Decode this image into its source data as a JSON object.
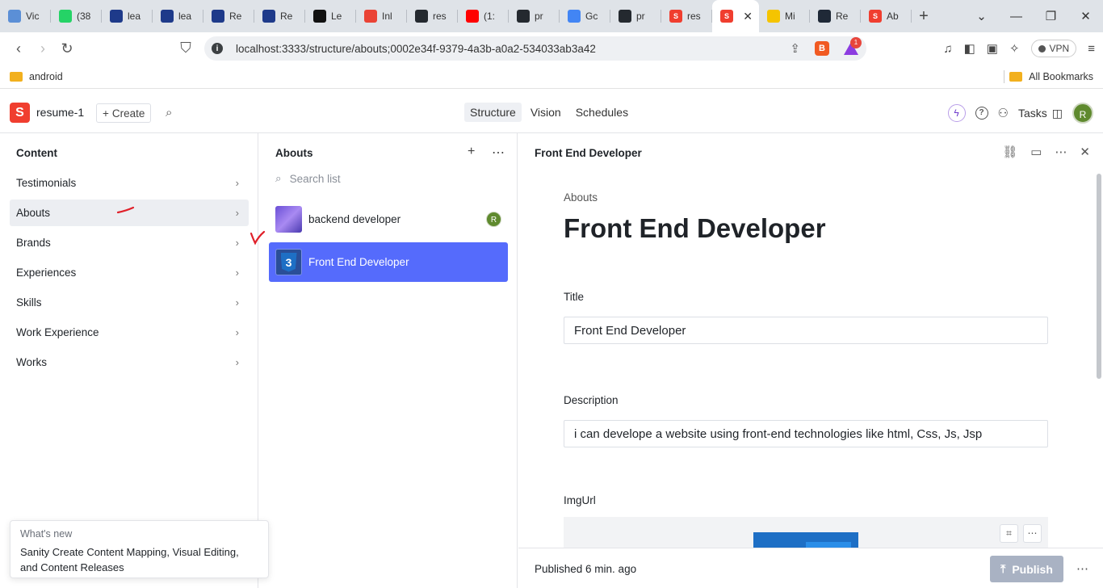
{
  "browser": {
    "tabs": [
      {
        "label": "Vic",
        "icon": "react-icon",
        "color": "#5b8fd6"
      },
      {
        "label": "(38",
        "icon": "whatsapp-icon",
        "color": "#25d366",
        "badge": "38"
      },
      {
        "label": "lea",
        "icon": "nxtwave-icon",
        "color": "#1e3a8a"
      },
      {
        "label": "lea",
        "icon": "nxtwave-icon",
        "color": "#1e3a8a"
      },
      {
        "label": "Re",
        "icon": "nxtwave-icon",
        "color": "#1e3a8a"
      },
      {
        "label": "Re",
        "icon": "nxtwave-icon",
        "color": "#1e3a8a"
      },
      {
        "label": "Le",
        "icon": "hackerrank-icon",
        "color": "#111111"
      },
      {
        "label": "Inl",
        "icon": "gmail-icon",
        "color": "#ea4335"
      },
      {
        "label": "res",
        "icon": "github-icon",
        "color": "#24292f"
      },
      {
        "label": "(1:",
        "icon": "youtube-icon",
        "color": "#ff0000"
      },
      {
        "label": "pr",
        "icon": "github-icon",
        "color": "#24292f"
      },
      {
        "label": "Gc",
        "icon": "google-icon",
        "color": "#4285f4"
      },
      {
        "label": "pr",
        "icon": "github-icon",
        "color": "#24292f"
      },
      {
        "label": "res",
        "icon": "sanity-icon",
        "color": "#f03e2f"
      },
      {
        "label": "",
        "icon": "sanity-icon",
        "color": "#f03e2f",
        "active": true
      },
      {
        "label": "Mi",
        "icon": "mi-icon",
        "color": "#f5c400"
      },
      {
        "label": "Re",
        "icon": "react-icon",
        "color": "#1f2937"
      },
      {
        "label": "Ab",
        "icon": "sanity-icon",
        "color": "#f03e2f"
      }
    ],
    "url": "localhost:3333/structure/abouts;0002e34f-9379-4a3b-a0a2-534033ab3a42",
    "rewards_badge": "1",
    "vpn_label": "VPN",
    "bookmarks": {
      "left": "android",
      "right": "All Bookmarks"
    }
  },
  "studio": {
    "logo_letter": "S",
    "workspace": "resume-1",
    "create_label": "Create",
    "tabs": [
      {
        "label": "Structure",
        "active": true
      },
      {
        "label": "Vision"
      },
      {
        "label": "Schedules"
      }
    ],
    "tasks_label": "Tasks",
    "avatar_initial": "R"
  },
  "content_pane": {
    "title": "Content",
    "items": [
      {
        "label": "Testimonials"
      },
      {
        "label": "Abouts",
        "selected": true
      },
      {
        "label": "Brands"
      },
      {
        "label": "Experiences"
      },
      {
        "label": "Skills"
      },
      {
        "label": "Work Experience"
      },
      {
        "label": "Works"
      }
    ]
  },
  "list_pane": {
    "title": "Abouts",
    "search_placeholder": "Search list",
    "documents": [
      {
        "label": "backend developer",
        "avatar": "R"
      },
      {
        "label": "Front End Developer",
        "selected": true,
        "thumb_glyph": "3"
      }
    ]
  },
  "editor": {
    "header_title": "Front End Developer",
    "type_label": "Abouts",
    "doc_title": "Front End Developer",
    "fields": {
      "title_label": "Title",
      "title_value": "Front End Developer",
      "description_label": "Description",
      "description_value": "i can develope a website using front-end technologies like html, Css, Js, Jsp",
      "imgurl_label": "ImgUrl"
    },
    "status": "Published 6 min. ago",
    "publish_label": "Publish"
  },
  "whats_new": {
    "title": "What's new",
    "body": "Sanity Create Content Mapping, Visual Editing, and Content Releases"
  },
  "colors": {
    "accent": "#556bfc",
    "brand": "#f03e2f",
    "annotation": "#e0202a"
  }
}
